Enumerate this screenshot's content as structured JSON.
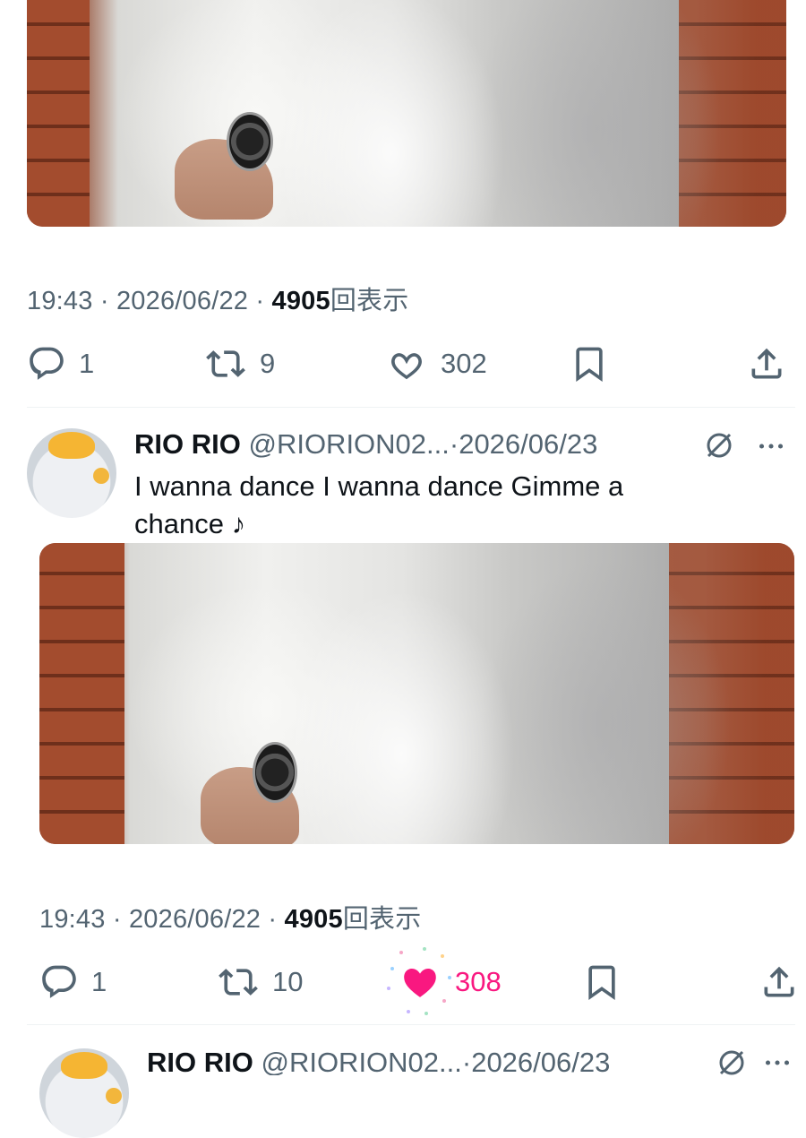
{
  "tweet1": {
    "meta": {
      "time": "19:43",
      "sep1": "·",
      "date": "2026/06/22",
      "sep2": "·",
      "views": "4905",
      "views_label": "回表示"
    },
    "actions": {
      "replies": "1",
      "reposts": "9",
      "likes": "302"
    }
  },
  "tweet2": {
    "user": {
      "name": "RIO RIO",
      "handle": "@RIORION02...",
      "sep": "·",
      "date": "2026/06/23"
    },
    "text": {
      "line1": "I wanna dance I wanna dance Gimme a",
      "line2": "chance ♪"
    },
    "meta": {
      "time": "19:43",
      "sep1": "·",
      "date": "2026/06/22",
      "sep2": "·",
      "views": "4905",
      "views_label": "回表示"
    },
    "actions": {
      "replies": "1",
      "reposts": "10",
      "likes": "308",
      "liked": true
    },
    "colors": {
      "like_active": "#f91880"
    }
  },
  "tweet3": {
    "user": {
      "name": "RIO RIO",
      "handle": "@RIORION02...",
      "sep": "·",
      "date": "2026/06/23"
    }
  },
  "colors": {
    "text": "#0f1419",
    "secondary": "#536471",
    "divider": "#eff3f4"
  },
  "icons": [
    "reply-icon",
    "repost-icon",
    "like-icon",
    "bookmark-icon",
    "share-icon",
    "grok-icon",
    "more-icon"
  ]
}
